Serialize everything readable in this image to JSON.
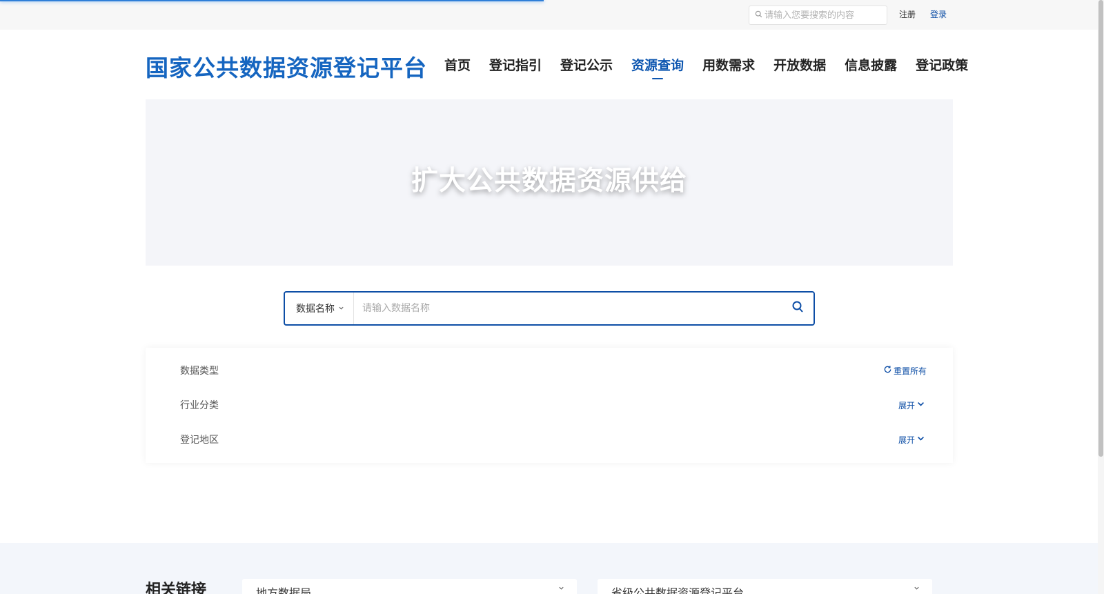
{
  "topbar": {
    "search_icon": "search-icon",
    "search_placeholder": "请输入您要搜索的内容",
    "register": "注册",
    "login": "登录"
  },
  "header": {
    "logo": "国家公共数据资源登记平台",
    "nav": [
      "首页",
      "登记指引",
      "登记公示",
      "资源查询",
      "用数需求",
      "开放数据",
      "信息披露",
      "登记政策"
    ],
    "active_nav": "资源查询"
  },
  "banner": {
    "text": "扩大公共数据资源供给"
  },
  "search": {
    "type_label": "数据名称",
    "type_icon": "chevron-down-icon",
    "placeholder": "请输入数据名称",
    "button_icon": "search-icon"
  },
  "filters": {
    "rows": [
      {
        "label": "数据类型",
        "action": "重置所有",
        "action_icon": "refresh-icon"
      },
      {
        "label": "行业分类",
        "action": "展开",
        "action_icon": "chevron-down-icon"
      },
      {
        "label": "登记地区",
        "action": "展开",
        "action_icon": "chevron-down-icon"
      }
    ]
  },
  "footer": {
    "title": "相关链接",
    "selects": [
      "地方数据局",
      "省级公共数据资源登记平台"
    ]
  },
  "colors": {
    "accent": "#0d4ea6",
    "logo": "#1565c0",
    "banner_bg": "#f4f5f9",
    "footer_bg": "#f3f6fb"
  }
}
